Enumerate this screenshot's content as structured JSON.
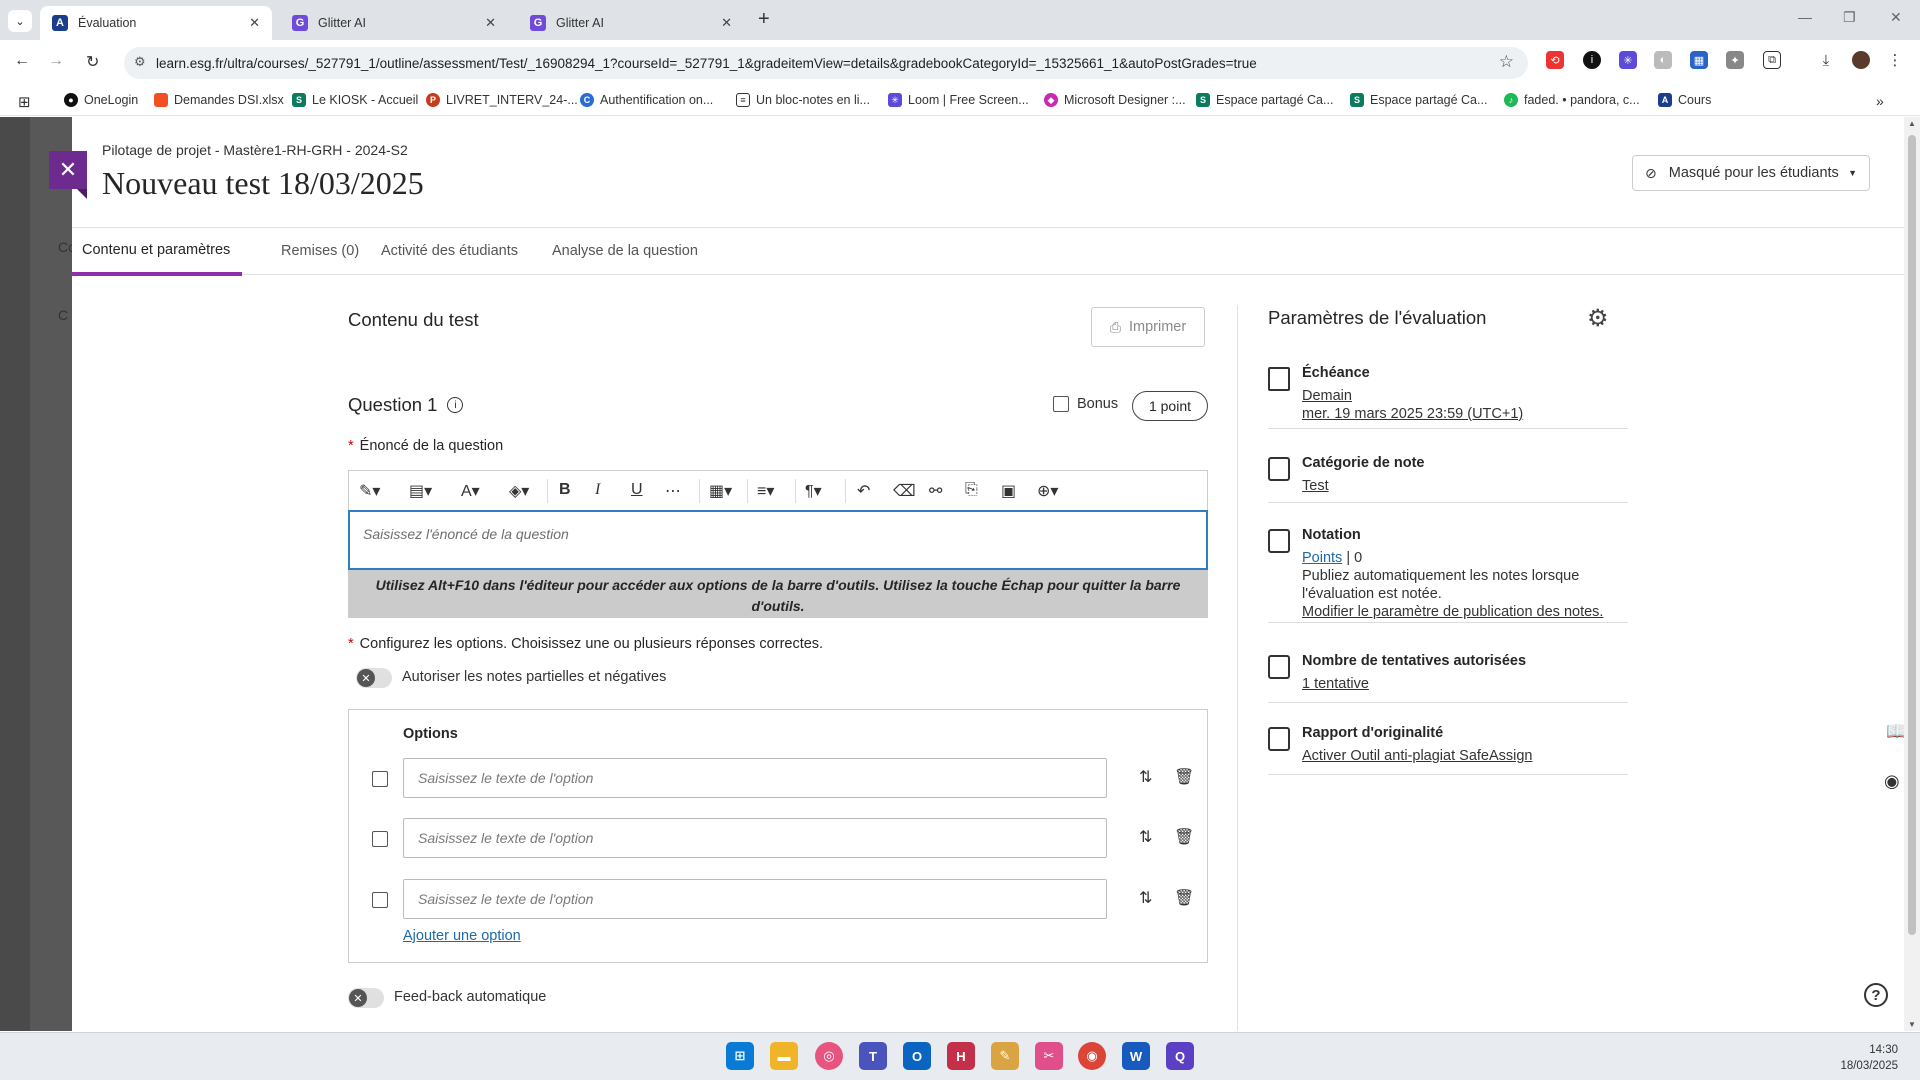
{
  "browser": {
    "tabs": [
      {
        "title": "Évaluation",
        "favicon_color": "#1a3e8c",
        "favicon_letter": "A"
      },
      {
        "title": "Glitter AI",
        "favicon_color": "#6e4bd8",
        "favicon_letter": "G"
      },
      {
        "title": "Glitter AI",
        "favicon_color": "#6e4bd8",
        "favicon_letter": "G"
      }
    ],
    "url": "learn.esg.fr/ultra/courses/_527791_1/outline/assessment/Test/_16908294_1?courseId=_527791_1&gradeitemView=details&gradebookCategoryId=_15325661_1&autoPostGrades=true",
    "bookmarks": [
      "OneLogin",
      "Demandes DSI.xlsx",
      "Le KIOSK - Accueil",
      "LIVRET_INTERV_24-...",
      "Authentification on...",
      "Un bloc-notes en li...",
      "Loom | Free Screen...",
      "Microsoft Designer :...",
      "Espace partagé Ca...",
      "Espace partagé Ca...",
      "faded. • pandora, c...",
      "Cours"
    ]
  },
  "page": {
    "breadcrumb": "Pilotage de projet - Mastère1-RH-GRH - 2024-S2",
    "title": "Nouveau test 18/03/2025",
    "visibility": "Masqué pour les étudiants",
    "bg_fragment_1": "Co",
    "bg_fragment_2": "C",
    "tabs": [
      "Contenu et paramètres",
      "Remises (0)",
      "Activité des étudiants",
      "Analyse de la question"
    ],
    "accent_color": "#8c2fa8"
  },
  "content": {
    "heading": "Contenu du test",
    "print_label": "Imprimer",
    "question_title": "Question 1",
    "bonus_label": "Bonus",
    "points_label": "1 point",
    "prompt_label": "Énoncé de la question",
    "prompt_placeholder": "Saisissez l'énoncé de la question",
    "editor_hint": "Utilisez Alt+F10 dans l'éditeur pour accéder aux options de la barre d'outils. Utilisez la touche Échap pour quitter la barre d'outils.",
    "config_label": "Configurez les options. Choisissez une ou plusieurs réponses correctes.",
    "partial_toggle_label": "Autoriser les notes partielles et négatives",
    "options_heading": "Options",
    "option_placeholders": [
      "Saisissez le texte de l'option",
      "Saisissez le texte de l'option",
      "Saisissez le texte de l'option"
    ],
    "add_option": "Ajouter une option",
    "feedback_toggle_label": "Feed-back automatique"
  },
  "settings": {
    "title": "Paramètres de l'évaluation",
    "due": {
      "head": "Échéance",
      "line1": "Demain",
      "line2": "mer. 19 mars 2025 23:59 (UTC+1)"
    },
    "category": {
      "head": "Catégorie de note",
      "value": "Test"
    },
    "grading": {
      "head": "Notation",
      "points_link": "Points",
      "points_sep": " | 0",
      "desc1": "Publiez automatiquement les notes lorsque",
      "desc2": "l'évaluation est notée.",
      "link": "Modifier le paramètre de publication des notes."
    },
    "attempts": {
      "head": "Nombre de tentatives autorisées",
      "value": "1 tentative"
    },
    "originality": {
      "head": "Rapport d'originalité",
      "value": "Activer Outil anti-plagiat SafeAssign"
    }
  },
  "taskbar": {
    "time": "14:30",
    "date": "18/03/2025"
  }
}
